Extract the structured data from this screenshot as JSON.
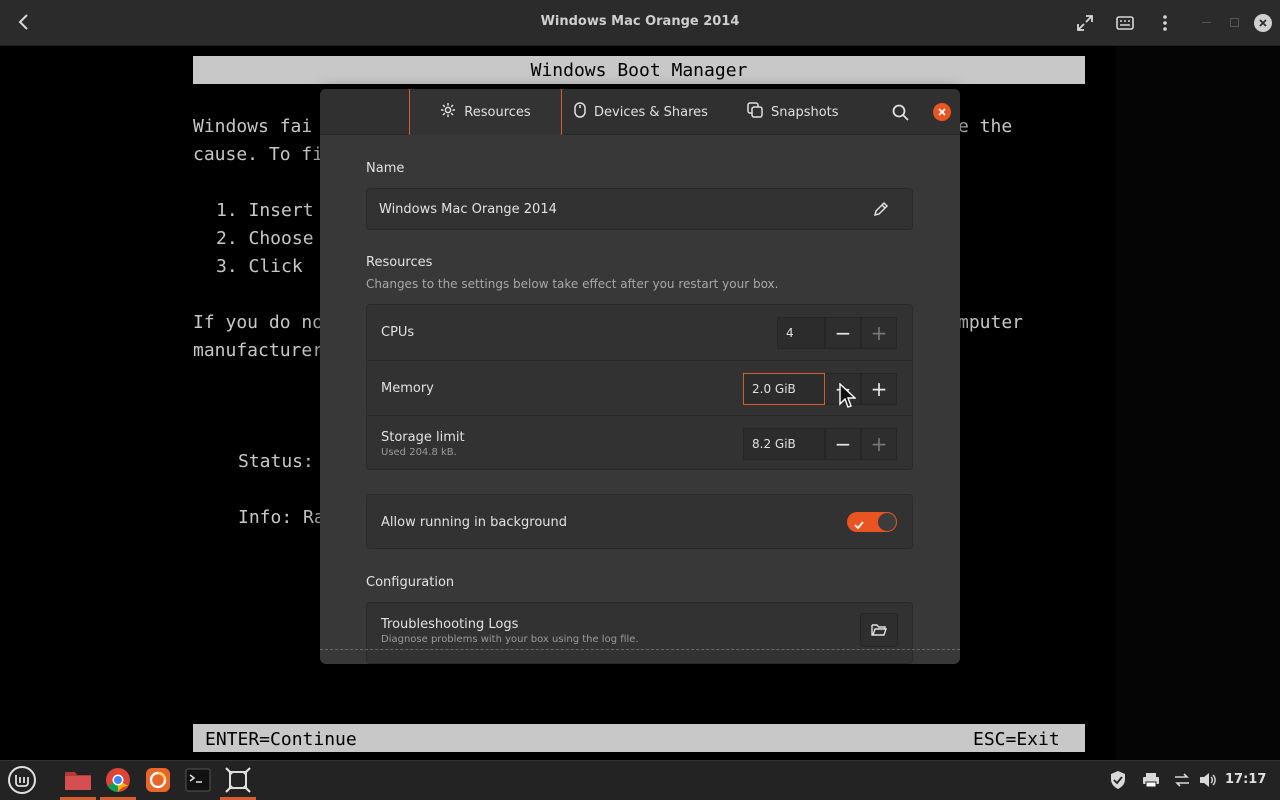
{
  "window": {
    "title": "Windows Mac Orange 2014",
    "back_icon": "back-arrow-icon",
    "fullscreen_icon": "fullscreen-icon",
    "keyboard_icon": "keyboard-icon",
    "menu_icon": "kebab-menu-icon"
  },
  "guest": {
    "header": "Windows Boot Manager",
    "line1_left": "Windows fai",
    "line1_right": "e the",
    "line2": "cause. To fi",
    "item1": "1. Insert",
    "item2": "2. Choose",
    "item3": "3. Click",
    "line3_left": "If you do no",
    "line3_right": "mputer",
    "line4": "manufacturer",
    "status": "Status:",
    "info": "Info: Ra",
    "footer_left": "ENTER=Continue",
    "footer_right": "ESC=Exit"
  },
  "dialog": {
    "tabs": [
      {
        "label": "Resources",
        "icon": "gear-icon"
      },
      {
        "label": "Devices & Shares",
        "icon": "mouse-icon"
      },
      {
        "label": "Snapshots",
        "icon": "snapshot-icon"
      }
    ],
    "name_section": "Name",
    "name_value": "Windows Mac Orange 2014",
    "resources_section": "Resources",
    "resources_note": "Changes to the settings below take effect after you restart your box.",
    "cpus_label": "CPUs",
    "cpus_value": "4",
    "memory_label": "Memory",
    "memory_value": "2.0 GiB",
    "storage_label": "Storage limit",
    "storage_sub": "Used 204.8 kB.",
    "storage_value": "8.2 GiB",
    "background_label": "Allow running in background",
    "background_enabled": true,
    "config_section": "Configuration",
    "logs_label": "Troubleshooting Logs",
    "logs_sub": "Diagnose problems with your box using the log file."
  },
  "taskbar": {
    "clock": "17:17"
  },
  "colors": {
    "accent": "#d35f2f",
    "close": "#e95420"
  }
}
